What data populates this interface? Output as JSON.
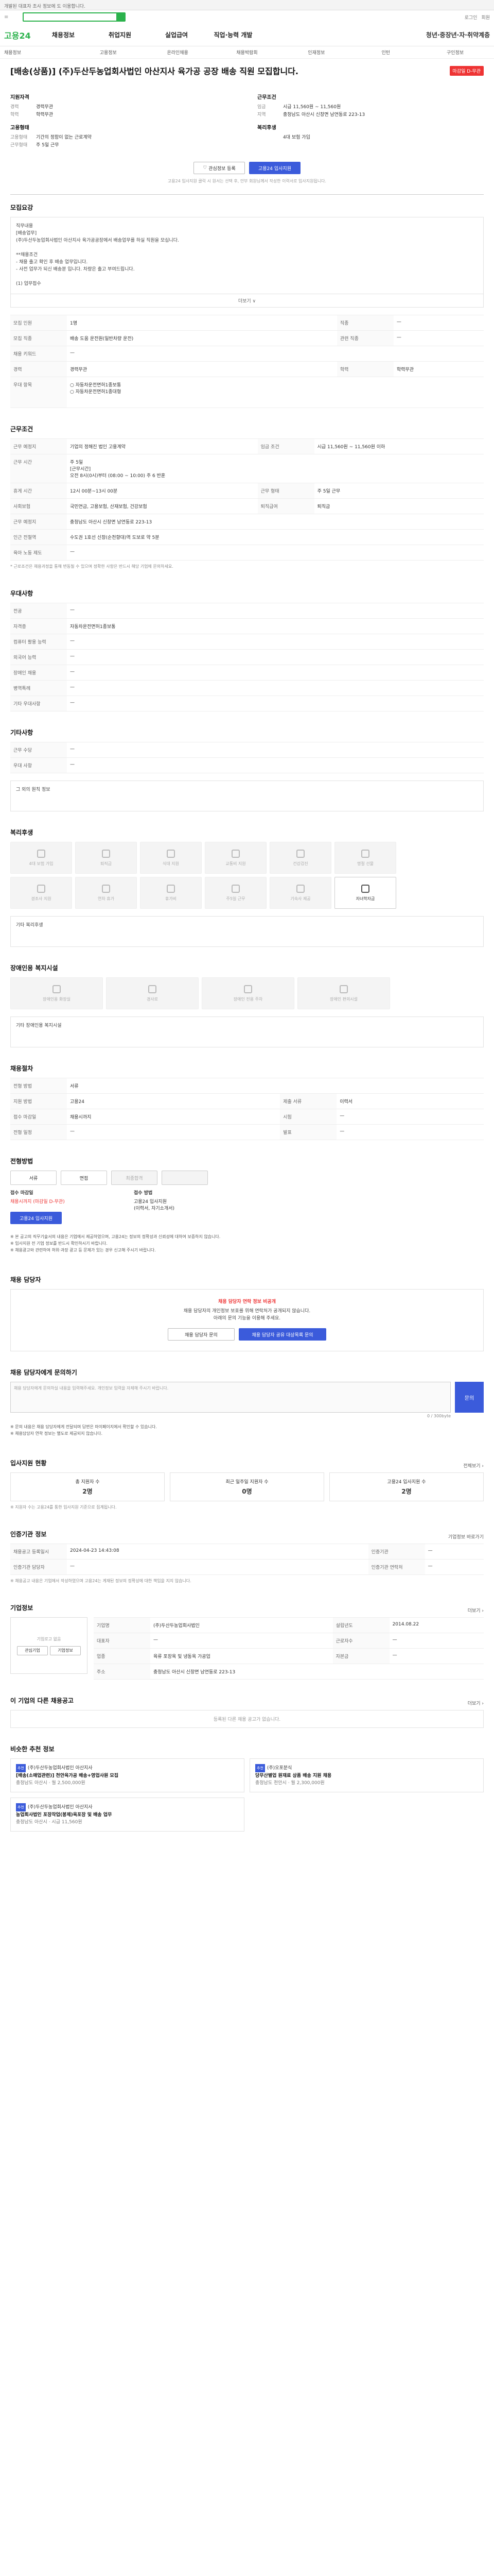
{
  "topbar": "개발된 대표자 조사 정보에 도 이용합니다.",
  "header": {
    "search_placeholder": "",
    "links": [
      "로그인",
      "회원"
    ]
  },
  "gnb": {
    "brand": "고용24",
    "items": [
      "채용정보",
      "취업지원",
      "실업급여",
      "직업·능력 개발"
    ],
    "last": "청년·중장년·자·취약계층"
  },
  "sub": [
    "채용정보",
    "고용정보",
    "온라인채용",
    "채용박람회",
    "인재정보",
    "인턴",
    "구인정보"
  ],
  "job": {
    "title": "[배송(상품)] (주)두산두농업회사법인 아산지사 육가공 공장 배송 직원 모집합니다.",
    "badge": "마감일 D-무관",
    "left_h": "지원자격",
    "left": [
      {
        "k": "경력",
        "v": "경력무관"
      },
      {
        "k": "학력",
        "v": "학력무관"
      }
    ],
    "left_h2": "고용형태",
    "left2": [
      {
        "k": "고용형태",
        "v": "기간의 정함이 없는 근로계약"
      },
      {
        "k": "근무형태",
        "v": "주 5일 근무"
      }
    ],
    "right_h": "근무조건",
    "right": [
      {
        "k": "임금",
        "v": "시급 11,560원 ~ 11,560원"
      },
      {
        "k": "지역",
        "v": "충청남도 아산시 신창면 남연동로 223-13"
      }
    ],
    "right_h2": "복리후생",
    "right2": [
      {
        "k": "",
        "v": "4대 보험 가입"
      }
    ],
    "btn1": "관심정보 등록",
    "btn2": "고용24 입사지원",
    "note": "고용24 입사지원 클릭 시 원서는 선택 후, 안부 회원님께서 작성한 이력서로 입사지원됩니다."
  },
  "s1": {
    "h": "모집요강",
    "box": "직무내용\n[배송업무]\n(주)두산두농업회사법인 아산지사 육가공공장에서 배송업무를 하실 직원을 모십니다.\n\n**채용조건\n- 채용 출고 확인 후 배송 업무입니다.\n- 사전 업무가 되신 배송분 입니다. 차량은 출고 부여드립니다.\n\n(1) 업무접수",
    "more": "더보기 ∨"
  },
  "s1t": [
    [
      "모집 인원",
      "1명",
      "직종",
      "—"
    ],
    [
      "모집 직종",
      "배송 도움 운전원(일반차량 운전)",
      "관련 직종",
      "—"
    ],
    [
      "채용 키워드",
      "—",
      "",
      ""
    ],
    [
      "경력",
      "경력무관",
      "학력",
      "학력무관"
    ],
    [
      "우대 항목",
      "○ 자동차운전면허1종보통\n○ 자동차운전면허1종대형",
      "",
      ""
    ]
  ],
  "s2": {
    "h": "근무조건",
    "rows": [
      [
        "근무 예정지",
        "기업의 정해진 법인 고용계약",
        "임금 조건",
        "시급 11,560원 ~ 11,560원 이하"
      ],
      [
        "근무 시간",
        "주 5일\n[근무시간]\n오전 8시(0시)부터 (08:00 ~ 10:00) 주 6 반훈",
        "",
        ""
      ],
      [
        "휴게 시간",
        "12시 00분~13시 00분",
        "근무 형태",
        "주 5일 근무"
      ],
      [
        "사회보험",
        "국민연금, 고용보험, 산재보험, 건강보험",
        "퇴직급여",
        "퇴직금"
      ],
      [
        "근무 예정지",
        "충청남도 아산시 신창면 남연동로 223-13",
        "",
        ""
      ],
      [
        "인근 전철역",
        "수도권 1호선 신창(순천향대)역 도보로 약 5분",
        "",
        ""
      ],
      [
        "육아 노동 제도",
        "—",
        "",
        ""
      ]
    ],
    "foot": "* 근로조건은 채용과정을 통해 변동될 수 있으며 정확한 사항은 반드시 해당 기업에 문의하세요."
  },
  "s3": {
    "h": "우대사항",
    "rows": [
      [
        "전공",
        "—"
      ],
      [
        "자격증",
        "자동차운전면허1종보통"
      ],
      [
        "컴퓨터 활용 능력",
        "—"
      ],
      [
        "외국어 능력",
        "—"
      ],
      [
        "장애인 채용",
        "—"
      ],
      [
        "병역특례",
        "—"
      ],
      [
        "기타 우대사항",
        "—"
      ]
    ]
  },
  "s4": {
    "h": "기타사항",
    "rows": [
      [
        "근무 수당",
        "—"
      ],
      [
        "우대 사항",
        "—"
      ]
    ],
    "sub": "그 외의 원칙 정보"
  },
  "s5": {
    "h": "복리후생",
    "items": [
      "4대 보험 가입",
      "퇴직금",
      "식대 지원",
      "교통비 지원",
      "건강검진",
      "명절 선물",
      "경조사 지원",
      "연차 휴가",
      "휴가비",
      "주5일 근무",
      "기숙사 제공",
      "자녀학자금"
    ],
    "on_index": 11,
    "foot": "기타 복리후생"
  },
  "s6": {
    "h": "장애인용 복지시설",
    "items": [
      "장애인용 화장실",
      "경사로",
      "장애인 전용 주차",
      "장애인 편의시설"
    ],
    "foot": "기타 장애인용 복지시설"
  },
  "s7": {
    "h": "채용절차",
    "rows": [
      [
        "전형 방법",
        "서류",
        "",
        ""
      ],
      [
        "지원 방법",
        "고용24",
        "제출 서류",
        "이력서"
      ],
      [
        "접수 마감일",
        "채용시까지",
        "시험",
        "—"
      ],
      [
        "전형 일정",
        "—",
        "발표",
        "—"
      ]
    ]
  },
  "s8": {
    "h": "전형방법",
    "steps": [
      "서류",
      "면접",
      "최종합격",
      ""
    ],
    "left_h": "접수 마감일",
    "left_v": "채용시까지 (마감일 D-무관)",
    "right_h": "접수 방법",
    "right_v": "고용24 입사지원\n(이력서, 자기소개서)",
    "apply": "고용24 입사지원",
    "notes": "※ 본 공고의 직무기술서의 내용은 기업에서 제공하였으며, 고용24는 정보의 정확성과 신뢰성에 대하여 보증하지 않습니다.\n※ 입사지원 전 기업 정보를 반드시 확인하시기 바랍니다.\n※ 채용광고와 관련하여 허위·과장 광고 등 문제가 있는 경우 신고해 주시기 바랍니다."
  },
  "s9": {
    "h": "채용 담당자",
    "t": "채용 담당자 연락 정보 비공개",
    "d": "채용 담당자의 개인정보 보호를 위해 연락처가 공개되지 않습니다.\n아래의 문의 기능을 이용해 주세요.",
    "b1": "채용 담당자 문의",
    "b2": "채용 담당자 공유 대상목록 문의"
  },
  "s10": {
    "h": "채용 담당자에게 문의하기",
    "ph": "채용 담당자에게 문의하실 내용을 입력해주세요. 개인정보 입력을 자제해 주시기 바랍니다.",
    "count": "0 / 300byte",
    "submit": "문의",
    "notes": "※ 문의 내용은 채용 담당자에게 전달되며 답변은 마이페이지에서 확인할 수 있습니다.\n※ 채용담당자 연락 정보는 별도로 제공되지 않습니다."
  },
  "s11": {
    "h": "입사지원 현황",
    "r": "전체보기 ›",
    "cards": [
      {
        "k": "총 지원자 수",
        "v": "2명"
      },
      {
        "k": "최근 일주일 지원자 수",
        "v": "0명"
      },
      {
        "k": "고용24 입사지원 수",
        "v": "2명"
      }
    ],
    "foot": "※ 지원자 수는 고용24를 통한 입사지원 기준으로 집계됩니다."
  },
  "s12": {
    "h": "인증기관 정보",
    "r": "기업정보 바로가기",
    "rows": [
      [
        "채용공고 등록일시",
        "2024-04-23 14:43:08",
        "인증기관",
        "—"
      ],
      [
        "인증기관 담당자",
        "—",
        "인증기관 연락처",
        "—"
      ]
    ],
    "foot": "※ 채용공고 내용은 기업에서 작성하였으며 고용24는 게재된 정보의 정확성에 대한 책임을 지지 않습니다."
  },
  "s13": {
    "h": "기업정보",
    "r": "더보기 ›",
    "logo": "기업로고 없음",
    "b1": "관심기업",
    "b2": "기업정보",
    "rows": [
      [
        "기업명",
        "(주)두산두농업회사법인",
        "설립년도",
        "2014.08.22"
      ],
      [
        "대표자",
        "—",
        "근로자수",
        "—"
      ],
      [
        "업종",
        "육류 포장육 및 냉동육 가공업",
        "자본금",
        "—"
      ],
      [
        "주소",
        "충청남도 아산시 신창면 남연동로 223-13",
        "",
        ""
      ]
    ]
  },
  "s14": {
    "h": "이 기업의 다른 채용공고",
    "r": "더보기 ›",
    "empty": "등록된 다른 채용 공고가 없습니다."
  },
  "s15": {
    "h": "비슷한 추천 정보",
    "cards": [
      {
        "tag": "추천",
        "co": "(주)두산두농업회사법인 아산지사",
        "t": "[배송(소매업관련)] 천안육가공 배송+영업사원 모집",
        "loc": "충청남도 아산시",
        "pay": "월 2,500,000원"
      },
      {
        "tag": "추천",
        "co": "(주)오포분식",
        "t": "당무산별업 원재료 상품 배송 지원 채용",
        "loc": "충청남도 천안시",
        "pay": "월 2,300,000원"
      },
      {
        "tag": "추천",
        "co": "(주)두산두농업회사법인 아산지사",
        "t": "농업회사법인 포장작업(봉제)육포장 및 배송 업무",
        "loc": "충청남도 아산시",
        "pay": "시급 11,560원"
      }
    ]
  }
}
